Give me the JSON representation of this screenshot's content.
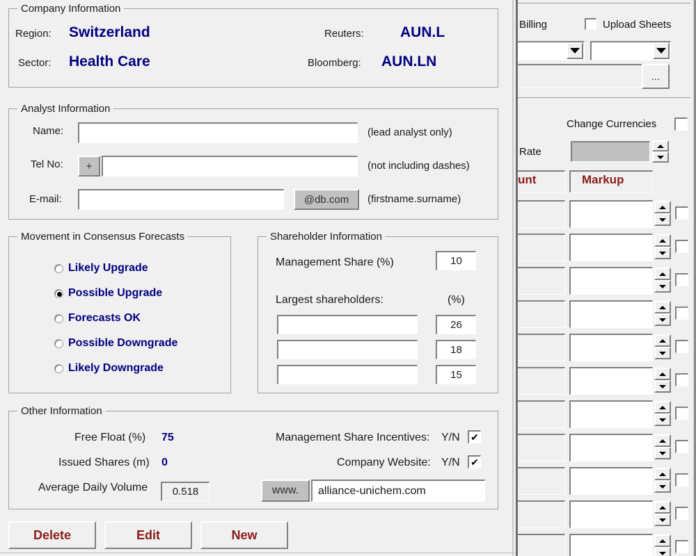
{
  "dialog": {
    "company_information": {
      "legend": "Company Information",
      "fields": [
        {
          "label": "Region:",
          "value": "Switzerland"
        },
        {
          "label": "Sector:",
          "value": "Health Care"
        },
        {
          "label": "Reuters:",
          "value": "AUN.L"
        },
        {
          "label": "Bloomberg:",
          "value": "AUN.LN"
        }
      ]
    },
    "analyst_information": {
      "legend": "Analyst Information",
      "name_label": "Name:",
      "name_value": "",
      "name_hint": "(lead analyst only)",
      "tel_label": "Tel No:",
      "tel_prefix_button": "+",
      "tel_value": "",
      "tel_hint": "(not including dashes)",
      "email_label": "E-mail:",
      "email_value": "",
      "email_domain_button": "@db.com",
      "email_hint": "(firstname.surname)"
    },
    "movement_in_consensus_forecasts": {
      "legend": "Movement in Consensus Forecasts",
      "options": [
        {
          "label": "Likely Upgrade",
          "selected": false
        },
        {
          "label": "Possible Upgrade",
          "selected": true
        },
        {
          "label": "Forecasts OK",
          "selected": false
        },
        {
          "label": "Possible Downgrade",
          "selected": false
        },
        {
          "label": "Likely Downgrade",
          "selected": false
        }
      ]
    },
    "shareholder_information": {
      "legend": "Shareholder Information",
      "management_share_label": "Management Share (%)",
      "management_share_value": "10",
      "largest_shareholders_label": "Largest shareholders:",
      "percent_header": "(%)",
      "shareholders": [
        {
          "name": "",
          "percent": "26"
        },
        {
          "name": "",
          "percent": "18"
        },
        {
          "name": "",
          "percent": "15"
        }
      ]
    },
    "other_information": {
      "legend": "Other Information",
      "free_float_label": "Free Float (%)",
      "free_float_value": "75",
      "issued_shares_label": "Issued Shares (m)",
      "issued_shares_value": "0",
      "average_daily_volume_label": "Average Daily Volume",
      "average_daily_volume_value": "0.518",
      "mgmt_incentives_label": "Management Share Incentives:",
      "mgmt_incentives_yn": "Y/N",
      "mgmt_incentives_checked": true,
      "company_website_label": "Company Website:",
      "company_website_yn": "Y/N",
      "company_website_checked": true,
      "www_button": "www.",
      "website_value": "alliance-unichem.com"
    },
    "actions": {
      "delete": "Delete",
      "edit": "Edit",
      "new": "New"
    }
  },
  "background_window": {
    "billing_label": "Billing",
    "upload_sheets_label": "Upload Sheets",
    "upload_sheets_checked": false,
    "combo_left_value": "",
    "combo_right_value": "",
    "path_value": "",
    "browse_button": "...",
    "change_currencies_label": "Change Currencies",
    "change_currencies_checked": false,
    "rate_label": "Rate",
    "rate_value": "",
    "discount_label": "unt",
    "markup_label": "Markup",
    "rows": [
      {
        "name": "",
        "value": "",
        "checked": false
      },
      {
        "name": "",
        "value": "",
        "checked": false
      },
      {
        "name": "",
        "value": "",
        "checked": false
      },
      {
        "name": "",
        "value": "",
        "checked": false
      },
      {
        "name": "",
        "value": "",
        "checked": false
      },
      {
        "name": "",
        "value": "",
        "checked": false
      },
      {
        "name": "",
        "value": "",
        "checked": false
      },
      {
        "name": "",
        "value": "",
        "checked": false
      },
      {
        "name": "",
        "value": "",
        "checked": false
      },
      {
        "name": "",
        "value": "",
        "checked": false
      },
      {
        "name": "",
        "value": "",
        "checked": false
      }
    ]
  },
  "colors": {
    "value_blue": "#000080",
    "action_red": "#8b1a1a",
    "dialog_face": "#f0f0f0",
    "field_white": "#ffffff",
    "gray_face": "#c0c0c0",
    "border_gray": "#a0a0a0"
  }
}
